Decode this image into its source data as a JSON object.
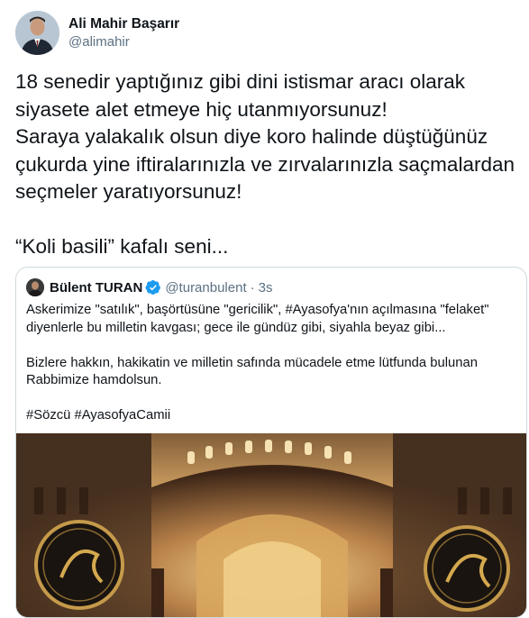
{
  "tweet": {
    "author_name": "Ali Mahir Başarır",
    "author_handle": "@alimahir",
    "lines": [
      "18 senedir yaptığınız gibi dini istismar aracı olarak",
      "siyasete alet etmeye hiç utanmıyorsunuz!",
      "Saraya yalakalık olsun diye koro halinde düştüğünüz",
      "çukurda yine iftiralarınızla ve zırvalarınızla saçmalardan",
      "seçmeler yaratıyorsunuz!",
      "“Koli basili” kafalı seni..."
    ]
  },
  "quoted": {
    "author_name": "Bülent TURAN",
    "author_handle": "@turanbulent",
    "separator": "·",
    "time": "3s",
    "lines": [
      "Askerimize \"satılık\", başörtüsüne \"gericilik\", #Ayasofya'nın açılmasına \"felaket\"",
      "diyenlerle bu milletin kavgası; gece ile gündüz gibi, siyahla beyaz gibi...",
      "Bizlere hakkın, hakikatin ve milletin safında mücadele etme lütfunda bulunan",
      "Rabbimize hamdolsun.",
      "#Sözcü #AyasofyaCamii"
    ]
  },
  "colors": {
    "text": "#0f1419",
    "secondary": "#5b7083",
    "verified": "#1d9bf0",
    "border": "#cfd9de"
  }
}
